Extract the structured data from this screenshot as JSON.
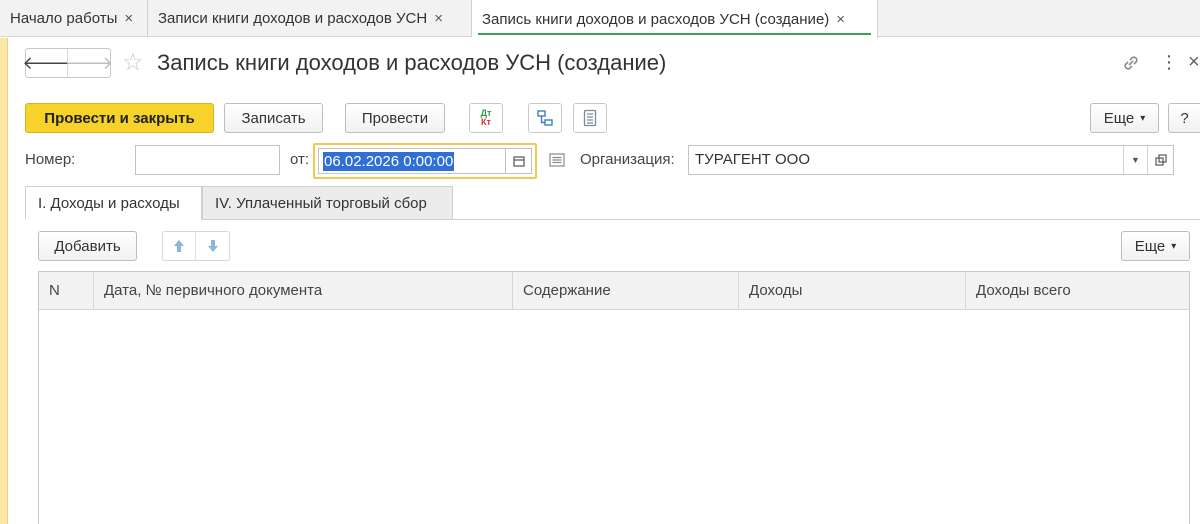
{
  "tabs": [
    {
      "label": "Начало работы",
      "close": "×"
    },
    {
      "label": "Записи книги доходов и расходов УСН",
      "close": "×"
    },
    {
      "label": "Запись книги доходов и расходов УСН (создание)",
      "close": "×"
    }
  ],
  "header": {
    "title": "Запись книги доходов и расходов УСН (создание)",
    "back_glyph": "🡐",
    "forward_glyph": "🡒",
    "star_glyph": "☆",
    "more_glyph": "⋮",
    "close_glyph": "×"
  },
  "toolbar": {
    "post_and_close": "Провести и закрыть",
    "save": "Записать",
    "post": "Провести",
    "dt_label": "Дт",
    "kt_label": "Кт",
    "more": "Еще",
    "more_caret": "▾",
    "help": "?"
  },
  "form": {
    "number_label": "Номер:",
    "number_value": "",
    "date_label": "от:",
    "date_value": "06.02.2026  0:00:00",
    "org_label": "Организация:",
    "org_value": "ТУРАГЕНТ ООО",
    "org_dropdown_glyph": "▼"
  },
  "inner_tabs": [
    {
      "label": "I. Доходы и расходы"
    },
    {
      "label": "IV. Уплаченный торговый сбор"
    }
  ],
  "table_toolbar": {
    "add": "Добавить",
    "more": "Еще",
    "more_caret": "▾"
  },
  "table": {
    "columns": [
      "N",
      "Дата, № первичного документа",
      "Содержание",
      "Доходы",
      "Доходы всего"
    ],
    "rows": []
  },
  "colors": {
    "accent_yellow": "#f6d22a",
    "active_tab_underline": "#3aa25a",
    "selection_blue": "#2f6fd6",
    "focus_border": "#f2c94c"
  },
  "icons": [
    "back-arrow-icon",
    "forward-arrow-icon",
    "star-icon",
    "link-icon",
    "kebab-icon",
    "close-icon",
    "dt-kt-icon",
    "structure-icon",
    "report-icon",
    "calendar-icon",
    "document-icon",
    "open-form-icon",
    "arrow-up-icon",
    "arrow-down-icon"
  ]
}
